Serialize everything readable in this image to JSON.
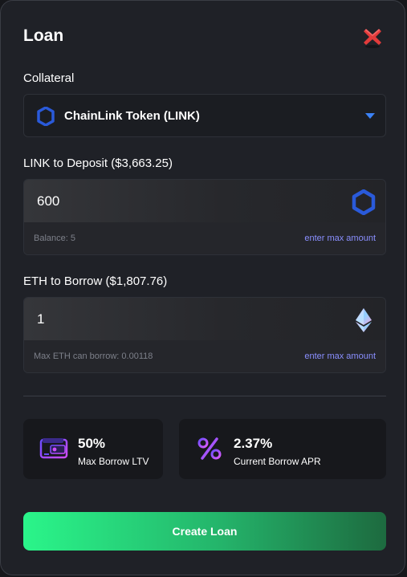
{
  "modal": {
    "title": "Loan",
    "close_icon": "close-x-icon"
  },
  "collateral": {
    "label": "Collateral",
    "selected": "ChainLink Token (LINK)",
    "icon": "chainlink-icon"
  },
  "deposit": {
    "label": "LINK to Deposit ($3,663.25)",
    "value": "600",
    "icon": "chainlink-icon",
    "hint": "Balance: 5",
    "max_label": "enter max amount"
  },
  "borrow": {
    "label": "ETH to Borrow ($1,807.76)",
    "value": "1",
    "icon": "ethereum-icon",
    "hint": "Max ETH can borrow: 0.00118",
    "max_label": "enter max amount"
  },
  "stats": [
    {
      "value": "50%",
      "label": "Max Borrow LTV",
      "icon": "wallet-icon"
    },
    {
      "value": "2.37%",
      "label": "Current Borrow APR",
      "icon": "percent-icon"
    }
  ],
  "actions": {
    "create_label": "Create Loan"
  },
  "colors": {
    "accent_blue": "#2a5ada",
    "link_purple": "#8a8fff",
    "button_green": "#2af58a"
  }
}
